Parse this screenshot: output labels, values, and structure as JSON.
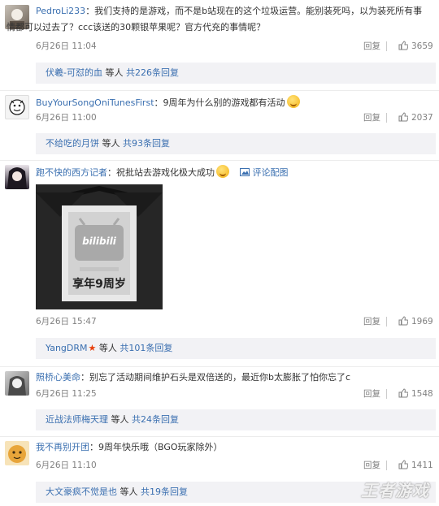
{
  "colors": {
    "link": "#3a6fb0",
    "text": "#333333",
    "meta": "#808080",
    "subbg": "#f2f2f5",
    "badge": "#e8400c"
  },
  "comments": [
    {
      "user": "PedroLi233",
      "text_line1": "：我们支持的是游戏，而不是b站现在的这个垃圾运营。能别装死吗，以为装死所有事",
      "text_line2": "情都可以过去了？ccc该送的30颗银苹果呢？官方代充的事情呢？",
      "time": "6月26日 11:04",
      "reply": "回复",
      "likes": "3659",
      "sub_user": "伏羲-可怼的血",
      "sub_mid": " 等人 ",
      "sub_count": "共226条回复"
    },
    {
      "user": "BuyYourSongOniTunesFirst",
      "text_line1": "：9周年为什么别的游戏都有活动",
      "time": "6月26日 11:00",
      "reply": "回复",
      "likes": "2037",
      "sub_user": "不给吃的月饼",
      "sub_mid": " 等人 ",
      "sub_count": "共93条回复"
    },
    {
      "user": "跑不快的西方记者",
      "text_line1": "：祝批站去游戏化极大成功",
      "pic_link": "评论配图",
      "image_logo": "bilibili",
      "image_caption": "享年9周岁",
      "time": "6月26日 15:47",
      "reply": "回复",
      "likes": "1969",
      "sub_user": "YangDRM",
      "sub_mid": " 等人 ",
      "sub_count": "共101条回复"
    },
    {
      "user": "照桥心美命",
      "text_line1": "：别忘了活动期间维护石头是双倍送的，最近你b太膨胀了怕你忘了c",
      "time": "6月26日 11:25",
      "reply": "回复",
      "likes": "1548",
      "sub_user": "近战法师梅天理",
      "sub_mid": " 等人 ",
      "sub_count": "共24条回复"
    },
    {
      "user": "我不再别开团",
      "text_line1": "：9周年快乐哦（BGO玩家除外）",
      "time": "6月26日 11:10",
      "reply": "回复",
      "likes": "1411",
      "sub_user": "大文豪疯不觉是也",
      "sub_mid": " 等人 ",
      "sub_count": "共19条回复"
    }
  ],
  "watermark": "王者游戏"
}
